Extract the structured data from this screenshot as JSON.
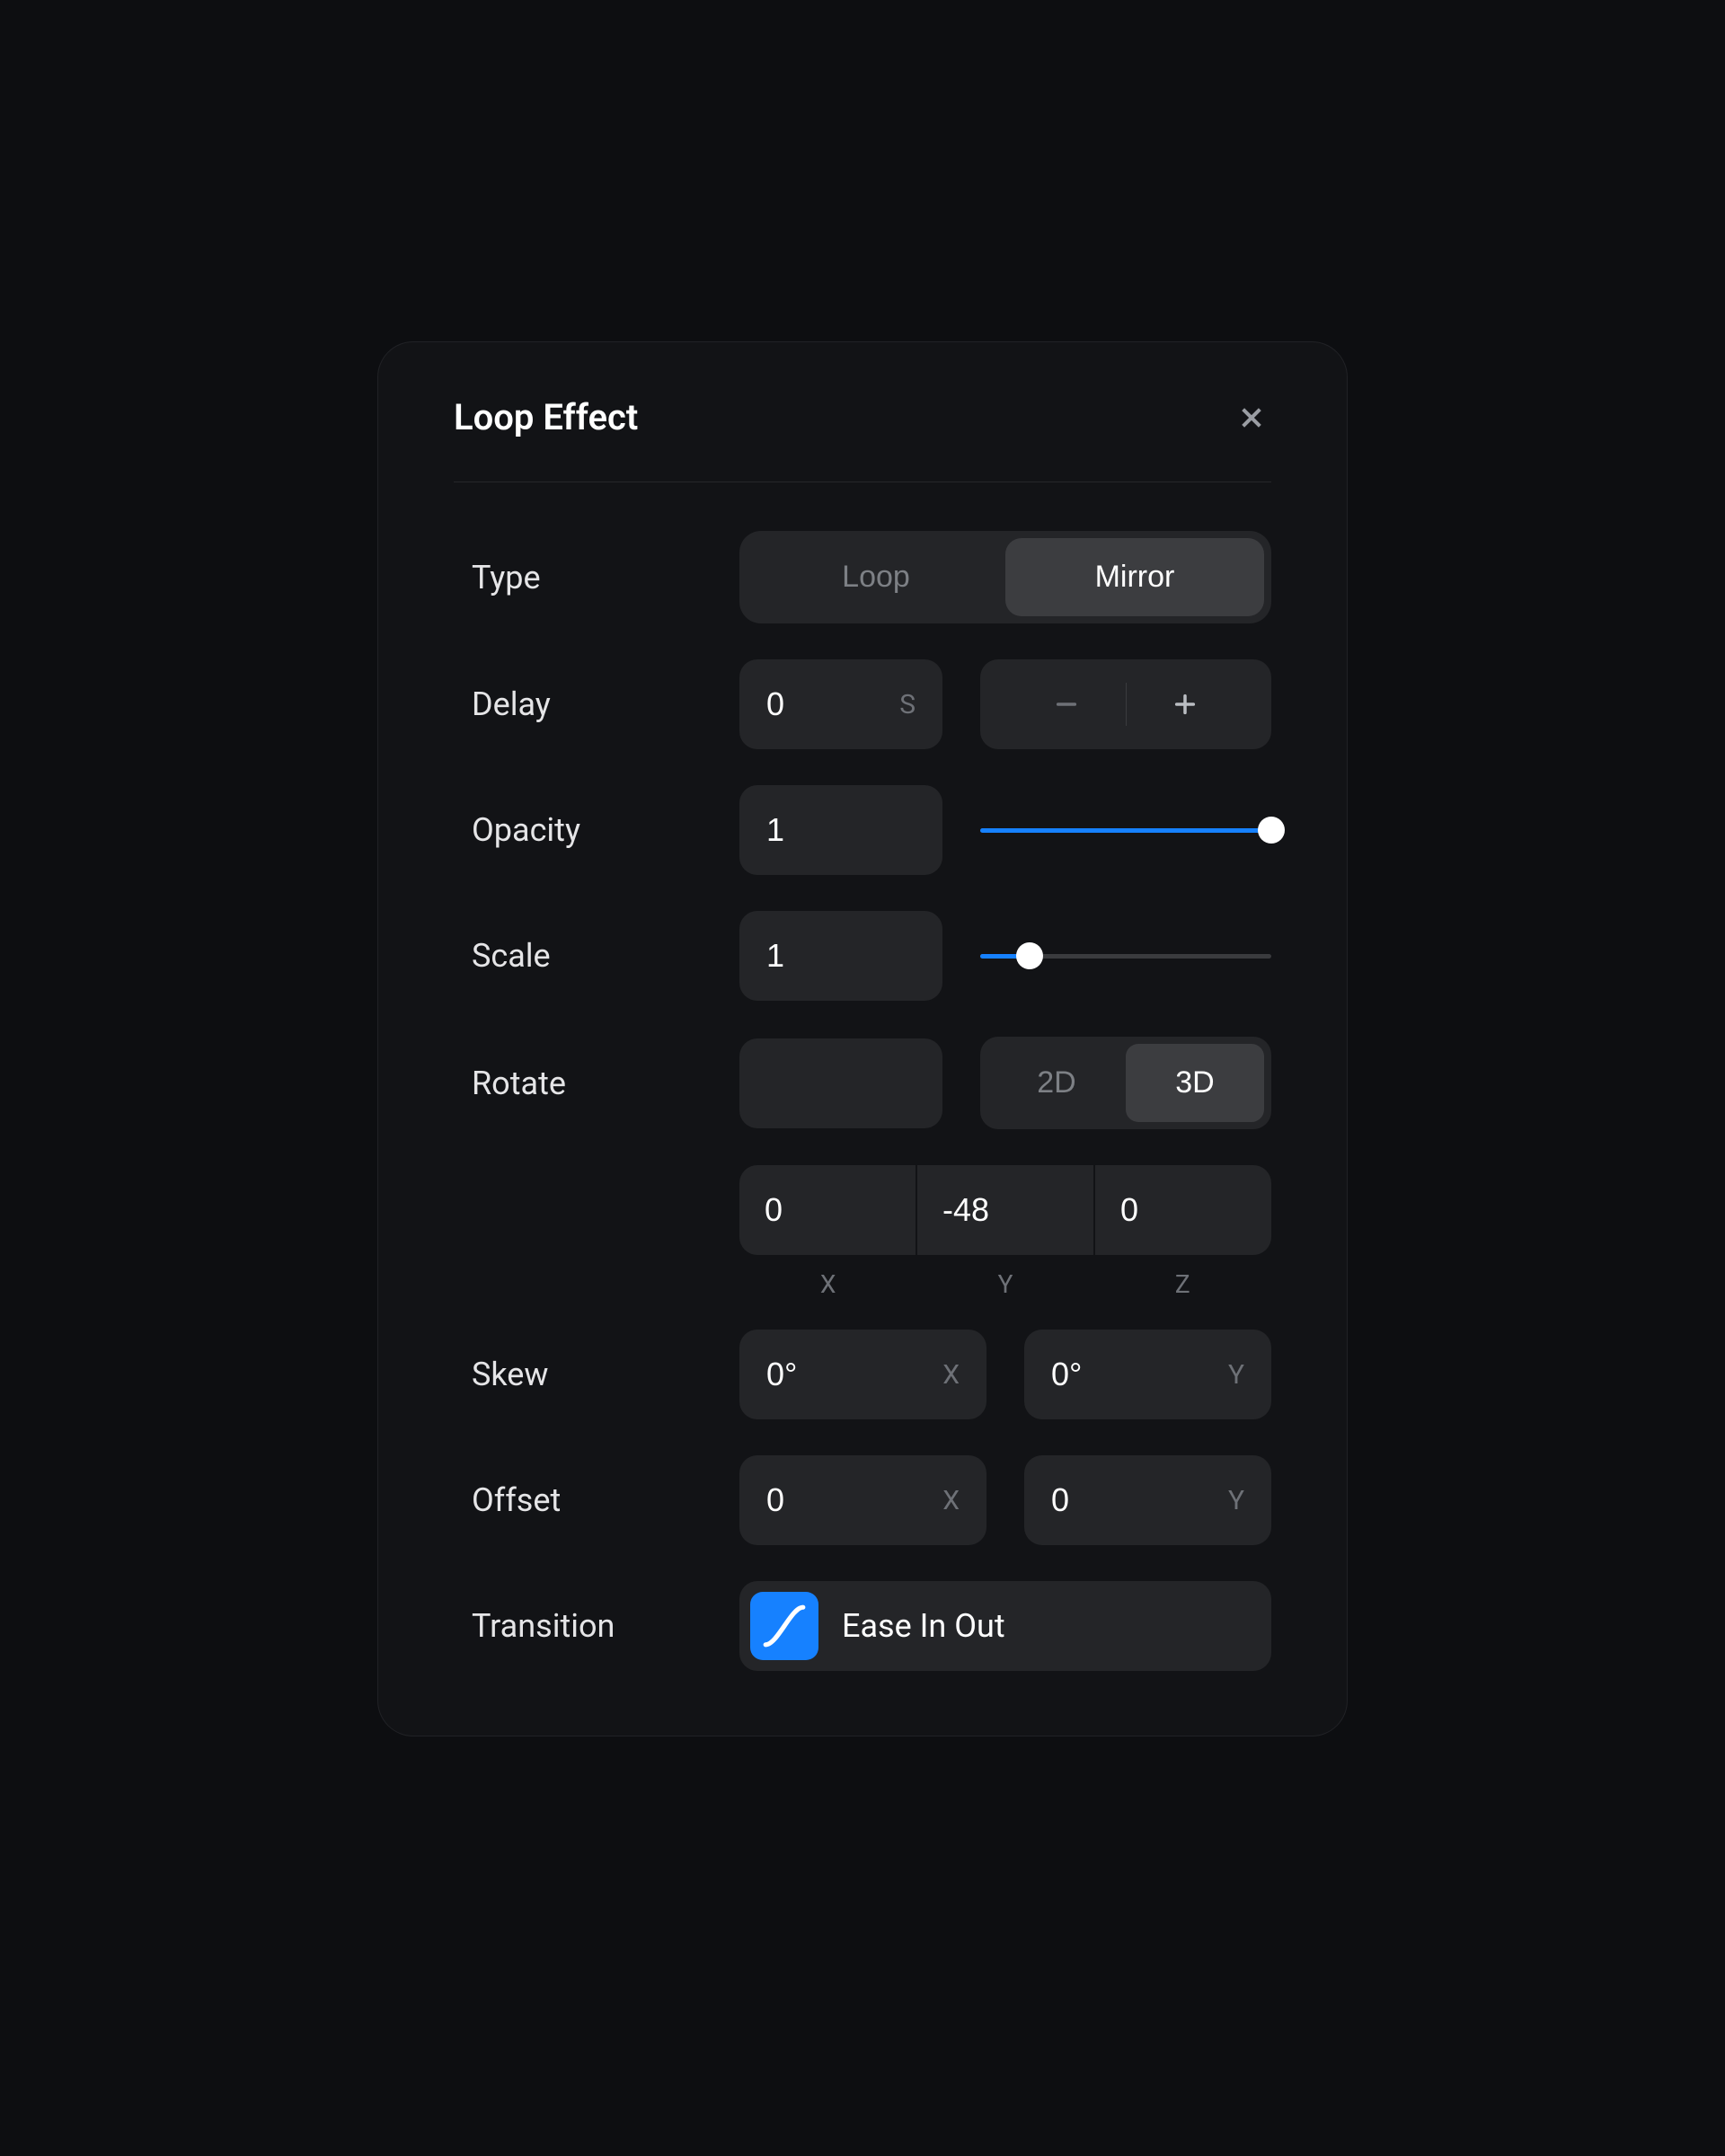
{
  "panel": {
    "title": "Loop Effect"
  },
  "type": {
    "label": "Type",
    "options": [
      "Loop",
      "Mirror"
    ],
    "selected": "Mirror"
  },
  "delay": {
    "label": "Delay",
    "value": "0",
    "unit": "S"
  },
  "opacity": {
    "label": "Opacity",
    "value": "1",
    "slider_percent": 100
  },
  "scale": {
    "label": "Scale",
    "value": "1",
    "slider_percent": 17
  },
  "rotate": {
    "label": "Rotate",
    "value": "",
    "dims": [
      "2D",
      "3D"
    ],
    "selected_dim": "3D",
    "x": "0",
    "y": "-48",
    "z": "0",
    "axis_x": "X",
    "axis_y": "Y",
    "axis_z": "Z"
  },
  "skew": {
    "label": "Skew",
    "x": "0°",
    "x_suffix": "X",
    "y": "0°",
    "y_suffix": "Y"
  },
  "offset": {
    "label": "Offset",
    "x": "0",
    "x_suffix": "X",
    "y": "0",
    "y_suffix": "Y"
  },
  "transition": {
    "label": "Transition",
    "value": "Ease In Out"
  }
}
